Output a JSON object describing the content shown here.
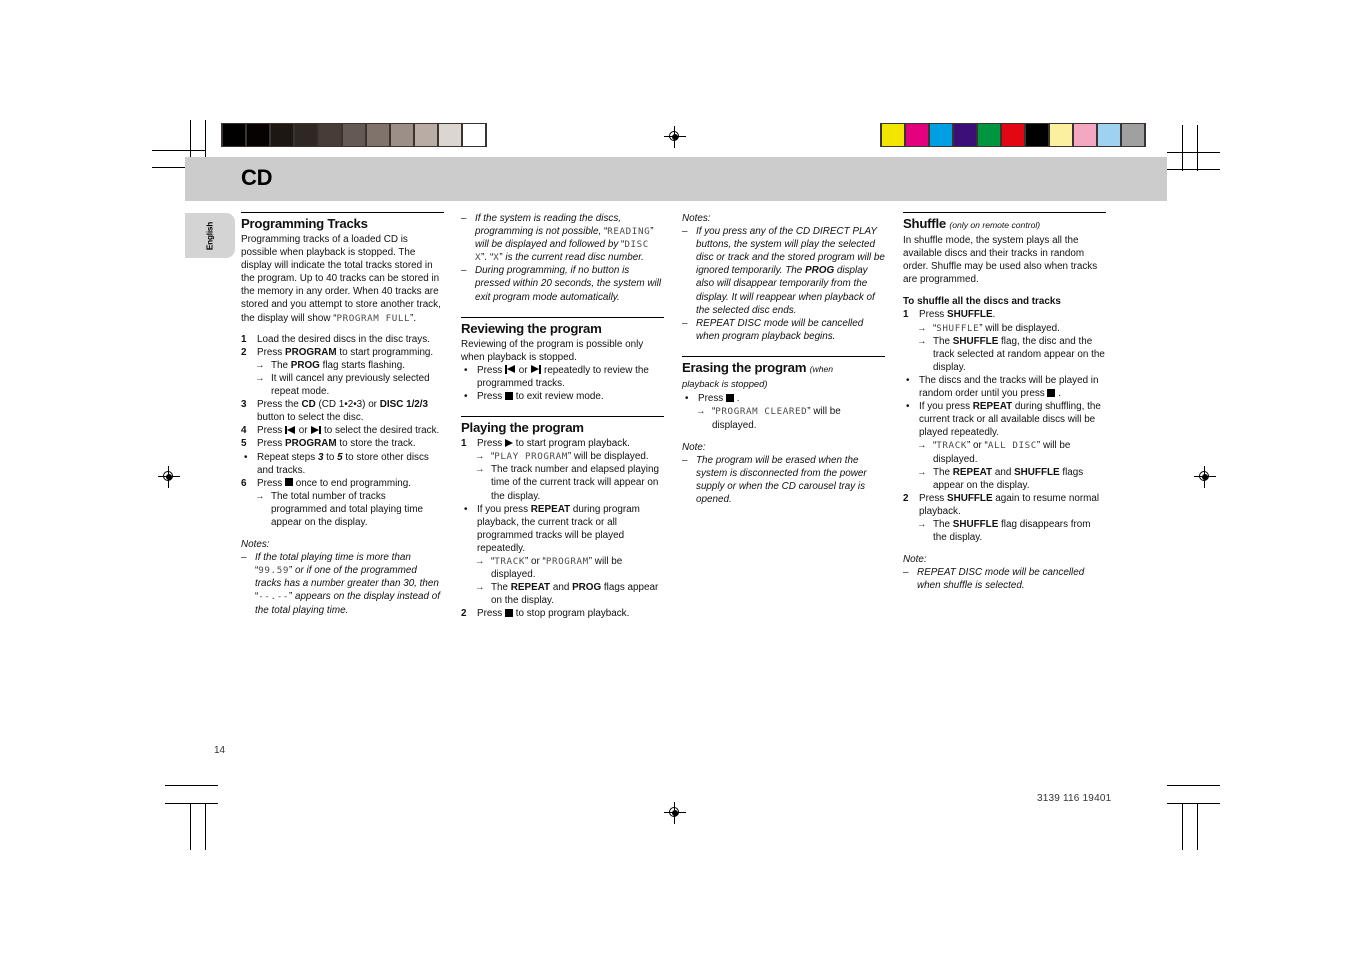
{
  "header": {
    "title": "CD",
    "language_tab": "English"
  },
  "footer": {
    "page_number": "14",
    "part_number": "3139 116 19401"
  },
  "calibration": {
    "grayscale_swatches": [
      "#000000",
      "#060202",
      "#1d1714",
      "#2f2723",
      "#473c37",
      "#655953",
      "#80736c",
      "#9b8f88",
      "#b8aca5",
      "#dcd6d0",
      "#ffffff"
    ],
    "color_swatches": [
      "#f2e500",
      "#e2007f",
      "#009fe3",
      "#3a1078",
      "#009640",
      "#e30613",
      "#000000",
      "#faf0a0",
      "#f4a7c0",
      "#9ed2f0",
      "#a0a0a0"
    ]
  },
  "col1": {
    "heading": "Programming Tracks",
    "intro_a": "Programming tracks of a loaded CD is possible when playback is stopped. The display will indicate the total tracks stored in the program. Up to 40 tracks can be stored in the memory in any order. When 40 tracks are stored and you attempt to store another track, the display will show",
    "intro_lcd_quote_open": "“",
    "intro_lcd": "PROGRAM FULL",
    "intro_lcd_quote_close": "”.",
    "steps": [
      {
        "num": "1",
        "text": "Load the desired discs in the disc trays."
      },
      {
        "num": "2",
        "text_pre": "Press ",
        "bold": "PROGRAM",
        "text_post": " to start programming."
      },
      {
        "num": "3",
        "text": "Press the "
      },
      {
        "num": "4",
        "text": "Press "
      },
      {
        "num": "5",
        "text_pre": "Press ",
        "bold": "PROGRAM",
        "text_post": " to store the track."
      },
      {
        "num": "6",
        "text": "Press "
      }
    ],
    "step2_arrow1_pre": "The ",
    "step2_arrow1_bold": "PROG",
    "step2_arrow1_post": " flag starts flashing.",
    "step2_arrow2": "It will cancel any previously selected repeat mode.",
    "step3_a": "Press the ",
    "step3_cd_bold": "CD",
    "step3_b": " (CD 1•2•3) or ",
    "step3_disc_bold": "DISC 1/2/3",
    "step3_c": " button to select the disc.",
    "step4_a": "Press ",
    "step4_b": " or ",
    "step4_c": " to select the desired track.",
    "bullet_repeat_a": "Repeat steps ",
    "bullet_repeat_3": "3",
    "bullet_repeat_b": " to ",
    "bullet_repeat_5": "5",
    "bullet_repeat_c": " to store other discs and tracks.",
    "step6_a": "Press ",
    "step6_b": " once to end programming.",
    "step6_arrow": "The total number of tracks programmed and total playing time appear on the display.",
    "notes_label": "Notes:",
    "note1_a": "If the total playing time is more than ",
    "note1_lcd1": "99.59",
    "note1_b": " or if one of the programmed tracks has a number greater than 30, then ",
    "note1_lcd2": "--.--",
    "note1_c": " appears on the display instead of the total playing time."
  },
  "col2": {
    "note_top_1_a": "If the system is reading the discs, programming is not possible, ",
    "note_top_1_lcd1": "READING",
    "note_top_1_b": " will be displayed and followed by ",
    "note_top_1_lcd2": "DISC X",
    "note_top_1_c": ". ",
    "note_top_1_lcd3": "X",
    "note_top_1_d": " is the current read disc number.",
    "note_top_2": "During programming,  if no button is pressed within 20 seconds, the system will exit program mode automatically.",
    "review_heading": "Reviewing the program",
    "review_intro": "Reviewing of the program is possible only when playback is stopped.",
    "review_b1_a": "Press ",
    "review_b1_b": " or ",
    "review_b1_c": " repeatedly to review the programmed tracks.",
    "review_b2_a": "Press ",
    "review_b2_b": " to exit review mode.",
    "playing_heading": "Playing the program",
    "play_step1_a": "Press ",
    "play_step1_b": " to start program playback.",
    "play_step1_arrow1_lcd": "PLAY PROGRAM",
    "play_step1_arrow1_post": " will be displayed.",
    "play_step1_arrow2": "The track number and elapsed playing time of the current track will appear on the display.",
    "play_bullet_a": "If you press ",
    "play_bullet_bold": "REPEAT",
    "play_bullet_b": " during program playback, the current track or all programmed tracks will be played repeatedly.",
    "play_bullet_arrow1_lcd1": "TRACK",
    "play_bullet_arrow1_mid": " or ",
    "play_bullet_arrow1_lcd2": "PROGRAM",
    "play_bullet_arrow1_post": " will be displayed.",
    "play_bullet_arrow2_a": "The ",
    "play_bullet_arrow2_b": "REPEAT",
    "play_bullet_arrow2_c": " and ",
    "play_bullet_arrow2_d": "PROG",
    "play_bullet_arrow2_e": " flags appear on the display.",
    "play_step2_a": "Press ",
    "play_step2_b": " to stop program playback."
  },
  "col3": {
    "notes_label": "Notes:",
    "note1_a": "If you press any of the CD DIRECT PLAY buttons, the system will play the selected disc or track and the stored program will be ignored temporarily. The ",
    "note1_bold": "PROG",
    "note1_b": " display also will disappear temporarily from the display. It will reappear when playback of the selected disc ends.",
    "note2": "REPEAT DISC mode will be cancelled when program playback begins.",
    "erasing_heading": "Erasing the program",
    "erasing_sub_a": "(when",
    "erasing_sub_b": "playback is stopped)",
    "erase_bullet_a": "Press ",
    "erase_bullet_b": " .",
    "erase_arrow_lcd": "PROGRAM CLEARED",
    "erase_arrow_post": " will be displayed.",
    "note_label": "Note:",
    "note3": "The program will be erased when the system is disconnected from the power supply or when the CD carousel tray is opened."
  },
  "col4": {
    "shuffle_heading": "Shuffle",
    "shuffle_sub": "(only on remote control)",
    "shuffle_intro": "In shuffle mode, the system plays all the available discs and their tracks in random order. Shuffle may be used also when tracks are programmed.",
    "shuffle_subhead": "To shuffle all the discs and tracks",
    "s1_a": "Press ",
    "s1_bold": "SHUFFLE",
    "s1_b": ".",
    "s1_arrow1_lcd": "SHUFFLE",
    "s1_arrow1_post": " will be displayed.",
    "s1_arrow2_a": "The ",
    "s1_arrow2_bold": "SHUFFLE",
    "s1_arrow2_b": " flag, the disc and the track selected at random appear on the display.",
    "bullet1_a": "The discs and the tracks will be played in random order until you press ",
    "bullet1_b": " .",
    "bullet2_a": "If you press ",
    "bullet2_bold": "REPEAT",
    "bullet2_b": " during shuffling, the current track or all available discs will be played repeatedly.",
    "bullet2_arrow1_lcd1": "TRACK",
    "bullet2_arrow1_mid": " or ",
    "bullet2_arrow1_lcd2": "ALL DISC",
    "bullet2_arrow1_post": " will be displayed.",
    "bullet2_arrow2_a": "The ",
    "bullet2_arrow2_b": "REPEAT",
    "bullet2_arrow2_c": " and ",
    "bullet2_arrow2_d": "SHUFFLE",
    "bullet2_arrow2_e": " flags appear on the display.",
    "s2_a": "Press ",
    "s2_bold": "SHUFFLE",
    "s2_b": " again to resume normal playback.",
    "s2_arrow_a": "The ",
    "s2_arrow_bold": "SHUFFLE",
    "s2_arrow_b": " flag disappears from the display.",
    "note_label": "Note:",
    "note1": "REPEAT DISC mode will be cancelled when shuffle is selected."
  }
}
